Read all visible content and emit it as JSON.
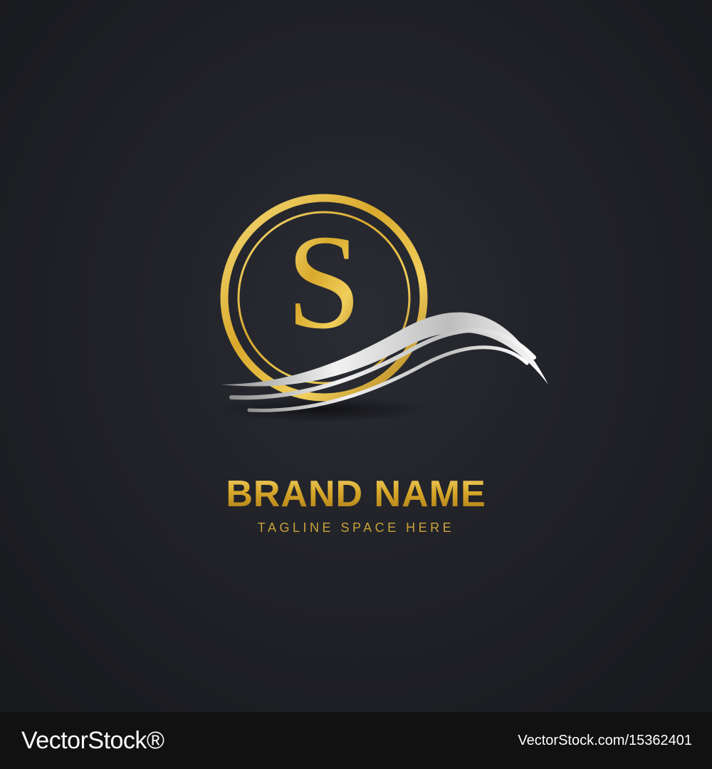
{
  "logo": {
    "monogram": "S",
    "brand_name": "BRAND NAME",
    "tagline": "TAGLINE SPACE HERE",
    "colors": {
      "gold_light": "#f3d36a",
      "gold": "#d7a72a",
      "gold_dark": "#a97814",
      "silver": "#e6e6e6",
      "background": "#212228"
    }
  },
  "watermark": {
    "site": "VectorStock®",
    "image_ref": "VectorStock.com/15362401"
  }
}
